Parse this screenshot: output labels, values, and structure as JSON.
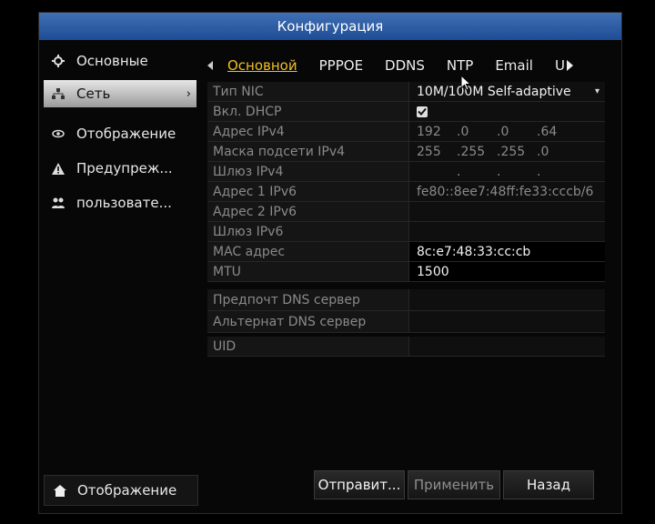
{
  "window": {
    "title": "Конфигурация"
  },
  "sidebar": {
    "items": [
      {
        "label": "Основные",
        "icon": "gear-icon"
      },
      {
        "label": "Сеть",
        "icon": "network-icon",
        "active": true
      },
      {
        "label": "Отображение",
        "icon": "eye-icon"
      },
      {
        "label": "Предупреж...",
        "icon": "warning-icon"
      },
      {
        "label": "пользовате...",
        "icon": "users-icon"
      }
    ],
    "bottom": {
      "label": "Отображение",
      "icon": "home-icon"
    }
  },
  "tabs": {
    "items": [
      "Основной",
      "PPPOE",
      "DDNS",
      "NTP",
      "Email",
      "U"
    ],
    "active": "Основной"
  },
  "form": {
    "nic_type": {
      "label": "Тип NIC",
      "value": "10M/100M Self-adaptive"
    },
    "dhcp": {
      "label": "Вкл. DHCP",
      "checked": true
    },
    "ipv4": {
      "label": "Адрес IPv4",
      "octets": [
        "192",
        ".0",
        ".0",
        ".64"
      ]
    },
    "mask": {
      "label": "Маска подсети IPv4",
      "octets": [
        "255",
        ".255",
        ".255",
        ".0"
      ]
    },
    "gateway": {
      "label": "Шлюз IPv4",
      "octets": [
        "",
        ".",
        ".",
        "."
      ]
    },
    "ipv6_1": {
      "label": "Адрес 1 IPv6",
      "value": "fe80::8ee7:48ff:fe33:cccb/6"
    },
    "ipv6_2": {
      "label": "Адрес 2 IPv6",
      "value": ""
    },
    "ipv6_gw": {
      "label": "Шлюз IPv6",
      "value": ""
    },
    "mac": {
      "label": "MAC адрес",
      "value": "8c:e7:48:33:cc:cb"
    },
    "mtu": {
      "label": "MTU",
      "value": "1500"
    },
    "dns_pref": {
      "label": "Предпочт DNS сервер",
      "value": ""
    },
    "dns_alt": {
      "label": "Альтернат DNS сервер",
      "value": ""
    },
    "uid": {
      "label": "UID",
      "value": ""
    }
  },
  "buttons": {
    "send": "Отправит...",
    "apply": "Применить",
    "back": "Назад"
  },
  "colors": {
    "title_bar": "#2f5fa8",
    "active_tab": "#f0c020"
  }
}
